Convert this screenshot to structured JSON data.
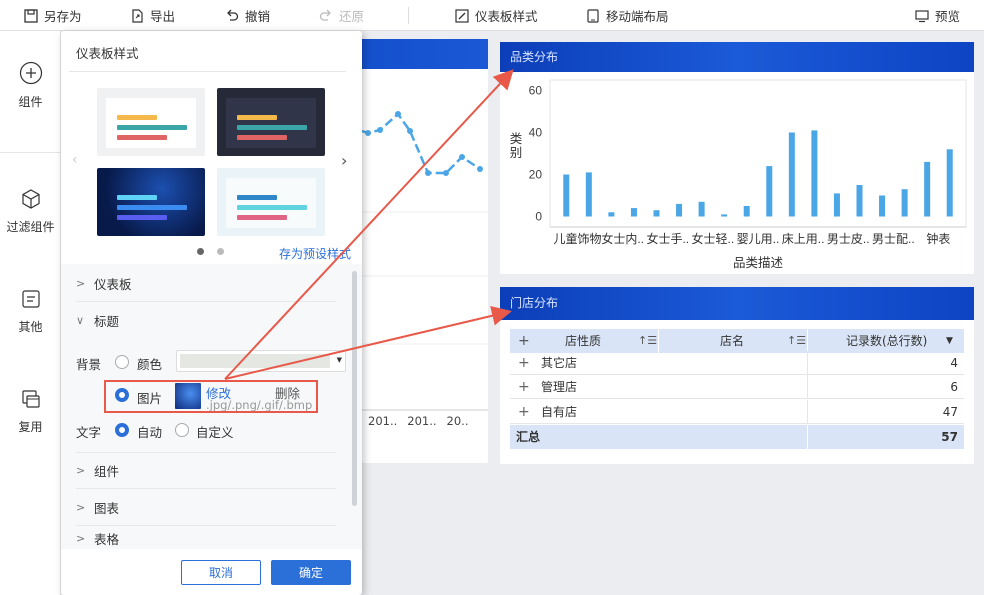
{
  "toolbar": {
    "save_as": "另存为",
    "export": "导出",
    "undo": "撤销",
    "redo": "还原",
    "dashboard_style": "仪表板样式",
    "mobile_layout": "移动端布局",
    "preview": "预览"
  },
  "sidebar": {
    "items": [
      "组件",
      "过滤组件",
      "其他",
      "复用"
    ]
  },
  "left_chart": {
    "x_labels": [
      "201..",
      "201..",
      "20.."
    ]
  },
  "category_chart": {
    "header": "品类分布",
    "chart_data": {
      "type": "bar",
      "xlabel": "品类描述",
      "ylabel": "类别",
      "y_ticks": [
        0,
        20,
        40,
        60
      ],
      "ylim": [
        -5,
        65
      ],
      "categories": [
        "儿童饰物",
        "",
        "女士内..",
        "",
        "女士手..",
        "",
        "女士轻..",
        "",
        "婴儿用..",
        "",
        "床上用..",
        "",
        "男士皮..",
        "",
        "男士配..",
        "",
        "钟表",
        ""
      ],
      "x_tick_labels": [
        "儿童饰物",
        "女士内..",
        "女士手..",
        "女士轻..",
        "婴儿用..",
        "床上用..",
        "男士皮..",
        "男士配..",
        "钟表"
      ],
      "values": [
        20,
        21,
        2,
        4,
        3,
        6,
        7,
        1,
        5,
        24,
        40,
        41,
        11,
        15,
        10,
        13,
        26,
        32
      ],
      "color": "#4ba6e6"
    }
  },
  "store_table": {
    "header": "门店分布",
    "columns": [
      "店性质",
      "店名",
      "记录数(总行数)"
    ],
    "rows": [
      {
        "name": "其它店",
        "count": "4"
      },
      {
        "name": "管理店",
        "count": "6"
      },
      {
        "name": "自有店",
        "count": "47"
      }
    ],
    "total_label": "汇总",
    "total_value": "57"
  },
  "popup": {
    "title": "仪表板样式",
    "save_preset": "存为预设样式",
    "sections": {
      "dashboard": "仪表板",
      "title": "标题",
      "component": "组件",
      "chart": "图表",
      "table": "表格"
    },
    "background_label": "背景",
    "color_option": "颜色",
    "image_option": "图片",
    "modify": "修改",
    "delete": "删除",
    "formats": ".jpg/.png/.gif/.bmp",
    "text_label": "文字",
    "auto_option": "自动",
    "custom_option": "自定义",
    "cancel": "取消",
    "confirm": "确定"
  },
  "colors": {
    "accent": "#2b6fd8",
    "header_blue": "#1450cc",
    "annotation_red": "#e8594a"
  }
}
